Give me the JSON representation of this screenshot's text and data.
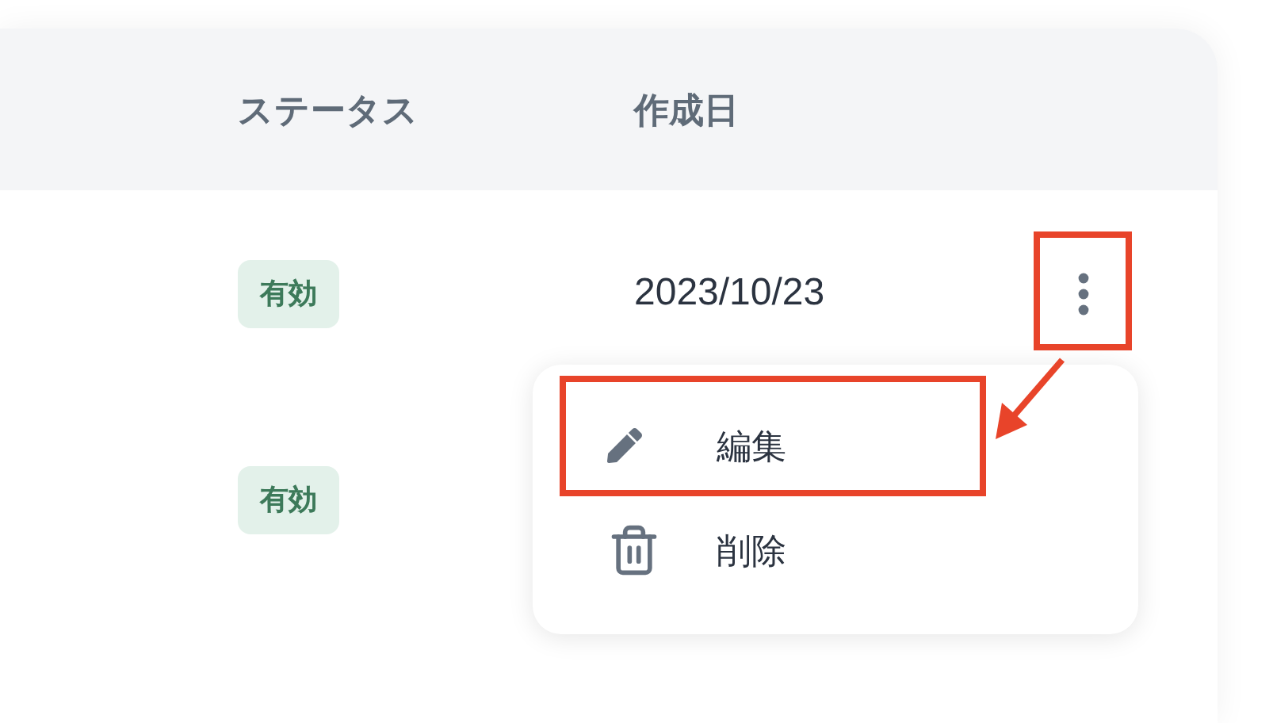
{
  "table": {
    "columns": [
      {
        "label": "ステータス"
      },
      {
        "label": "作成日"
      }
    ],
    "rows": [
      {
        "status": "有効",
        "date": "2023/10/23"
      },
      {
        "status": "有効"
      }
    ]
  },
  "menu": {
    "items": [
      {
        "kind": "edit",
        "label": "編集"
      },
      {
        "kind": "delete",
        "label": "削除"
      }
    ]
  }
}
